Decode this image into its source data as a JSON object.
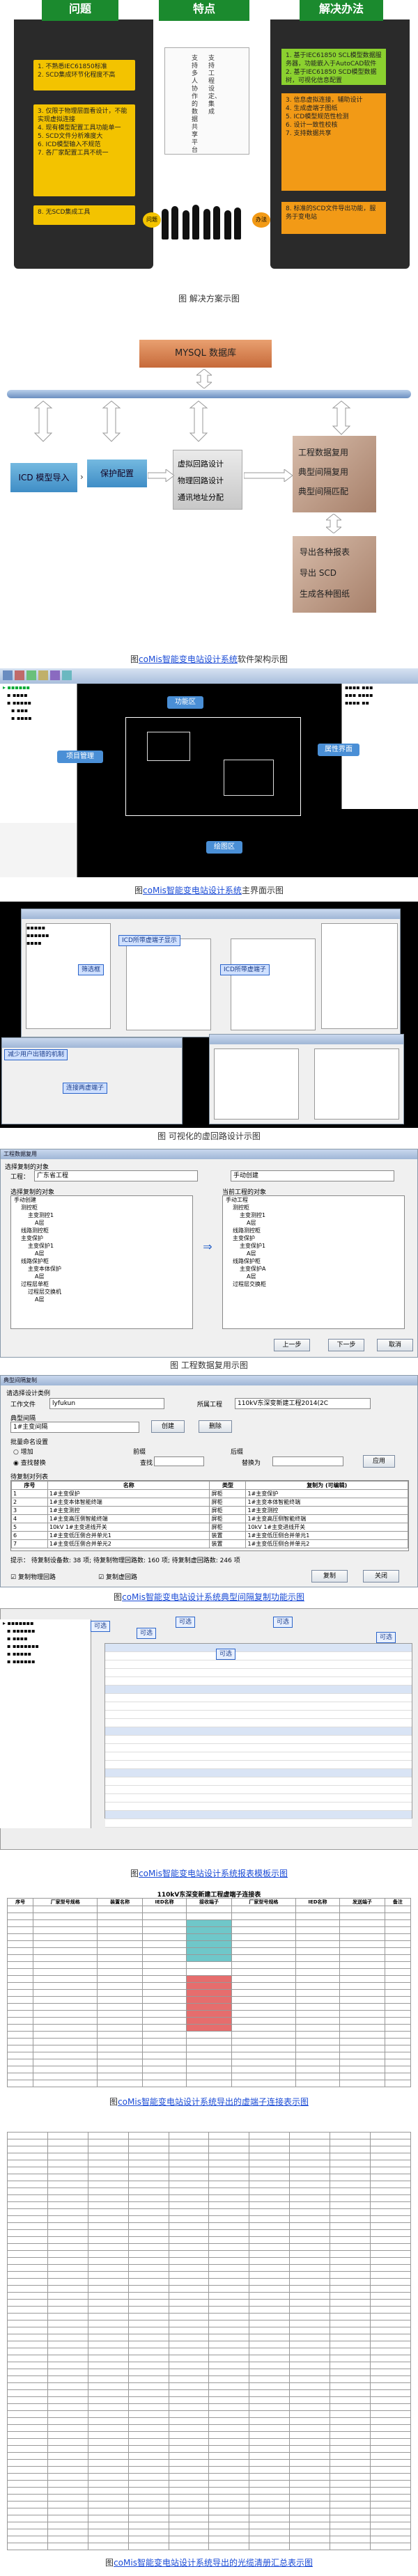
{
  "section1": {
    "headers": [
      "问题",
      "特点",
      "解决办法"
    ],
    "problems": [
      {
        "n": "1.",
        "text": "不熟悉IEC61850标准"
      },
      {
        "n": "2.",
        "text": "SCD集成环节化程度不高"
      },
      {
        "n": "3.",
        "text": "仅限于物理层面看设计，不能实现虚拟连接"
      },
      {
        "n": "4.",
        "text": "现有模型配置工具功能单一"
      },
      {
        "n": "5.",
        "text": "SCD文件分析难度大"
      },
      {
        "n": "6.",
        "text": "ICD模型输入不规范"
      },
      {
        "n": "7.",
        "text": "各厂家配置工具不统一"
      },
      {
        "n": "8.",
        "text": "无SCD集成工具"
      }
    ],
    "feature_lines": [
      "支持多人协作的数据共享平台",
      "支持工程设定、集成"
    ],
    "solutions": [
      {
        "n": "1.",
        "text": "基于IEC61850 SCL模型数据服务器，功能嵌入于AutoCAD软件"
      },
      {
        "n": "2.",
        "text": "基于IEC61850 SCD模型数据树，可视化信息配置"
      },
      {
        "n": "3.",
        "text": "信息虚拟连接，辅助设计"
      },
      {
        "n": "4.",
        "text": "生成虚端子图纸"
      },
      {
        "n": "5.",
        "text": "ICD模型规范性检测"
      },
      {
        "n": "6.",
        "text": "设计一致性校核"
      },
      {
        "n": "7.",
        "text": "支持数据共享"
      },
      {
        "n": "8.",
        "text": "标准的SCD文件导出功能，服务于变电站"
      }
    ],
    "left_badge": "问题",
    "right_badge": "办法",
    "caption": "图 解决方案示图"
  },
  "section2": {
    "db_label": "MYSQL 数据库",
    "icd_label": "ICD 模型导入",
    "protect_label": "保护配置",
    "virtual_lines": [
      "虚拟回路设计",
      "物理回路设计",
      "通讯地址分配"
    ],
    "project_lines": [
      "工程数据复用",
      "典型间隔复用",
      "典型间隔匹配"
    ],
    "export_lines": [
      "导出各种报表",
      "导出 SCD",
      "生成各种图纸"
    ],
    "caption_prefix": "图",
    "caption_link": "coMis智能变电站设计系统",
    "caption_suffix": "软件架构示图"
  },
  "section3": {
    "bubbles": [
      "功能区",
      "项目管理",
      "属性界面",
      "绘图区"
    ],
    "caption_prefix": "图",
    "caption_link": "coMis智能变电站设计系统",
    "caption_suffix": "主界面示图"
  },
  "section4": {
    "callouts": [
      "ICD所带虚端子显示",
      "筛选框",
      "ICD所带虚端子",
      "减少用户出错的机制",
      "连接两虚端子"
    ],
    "caption": "图 可视化的虚回路设计示图"
  },
  "section5": {
    "title": "工程数据复用",
    "label_project": "工程：",
    "project_value": "广东省工程",
    "label_copy": "选择复制的对象",
    "label_target": "当前工程的对象",
    "target_value": "手动创建",
    "tree_left": [
      "手动创建",
      "测控柜",
      "主变测控1",
      "A层",
      "线路测控柜",
      "主变保护",
      "主变保护1",
      "A层",
      "线路保护柜",
      "主变本体保护",
      "A层",
      "过程层单柜",
      "过程层交换机",
      "A层"
    ],
    "tree_right": [
      "手动工程",
      "测控柜",
      "主变测控1",
      "A层",
      "线路测控柜",
      "主变保护",
      "主变保护1",
      "A层",
      "线路保护柜",
      "主变保护A",
      "A层",
      "过程层交换柜"
    ],
    "btn_prev": "上一步",
    "btn_next": "下一步",
    "btn_cancel": "取消",
    "caption": "图 工程数据复用示图"
  },
  "section6": {
    "title": "典型间隔复制",
    "label_select": "请选择设计类例",
    "label_station": "工作文件",
    "station_value": "lyfukun",
    "label_project": "所属工程",
    "project_value": "110kV东深变新建工程2014(2C",
    "label_typical": "典型间隔",
    "typical_value": "1#主变间隔",
    "btn_create": "创建",
    "btn_delete": "删除",
    "label_batch": "批量命名设置",
    "radio_add": "增加",
    "radio_replace": "查找替换",
    "label_prefix": "前缀",
    "label_suffix": "后缀",
    "label_find": "查找",
    "label_replace": "替换为",
    "btn_apply": "应用",
    "label_list": "待复制对列表",
    "columns": [
      "序号",
      "名称",
      "类型",
      "复制为 (可编辑)"
    ],
    "rows": [
      [
        "1",
        "1#主变保护",
        "屏柜",
        "1#主变保护"
      ],
      [
        "2",
        "1#主变本体智能终端",
        "屏柜",
        "1#主变本体智能终端"
      ],
      [
        "3",
        "1#主变测控",
        "屏柜",
        "1#主变测控"
      ],
      [
        "4",
        "1#主变高压侧智能终端",
        "屏柜",
        "1#主变高压侧智能终端"
      ],
      [
        "5",
        "10kV 1#主变进线开关",
        "屏柜",
        "10kV 1#主变进线开关"
      ],
      [
        "6",
        "1#主变低压侧合并单元1",
        "装置",
        "1#主变低压侧合并单元1"
      ],
      [
        "7",
        "1#主变低压侧合并单元2",
        "装置",
        "1#主变低压侧合并单元2"
      ]
    ],
    "status": "提示：  待复制设备数: 38 项; 待复制物理回路数: 160 项; 待复制虚回路数: 246 项",
    "check1": "复制物理回路",
    "check2": "复制虚回路",
    "btn_copy": "复制",
    "btn_close": "关闭",
    "caption_prefix": "图",
    "caption_link": "coMis智能变电站设计系统典型间隔复制功能示图",
    "caption_suffix": ""
  },
  "section7": {
    "callouts": [
      "可选",
      "可选",
      "可选",
      "可选",
      "可选",
      "可选"
    ],
    "caption_prefix": "图",
    "caption_link": "coMis智能变电站设计系统报表模板示图",
    "caption_suffix": ""
  },
  "section8": {
    "table_title": "110kV东深变新建工程虚端子连接表",
    "columns": [
      "序号",
      "厂家型号规格",
      "装置名称",
      "IED名称",
      "接收端子",
      "厂家型号规格",
      "IED名称",
      "发送端子",
      "备注"
    ],
    "caption_prefix": "图",
    "caption_link": "coMis智能变电站设计系统导出的虚端子连接表示图",
    "caption_suffix": ""
  },
  "section9": {
    "caption_prefix": "图",
    "caption_link": "coMis智能变电站设计系统导出的光缆清册汇总表示图",
    "caption_suffix": ""
  }
}
